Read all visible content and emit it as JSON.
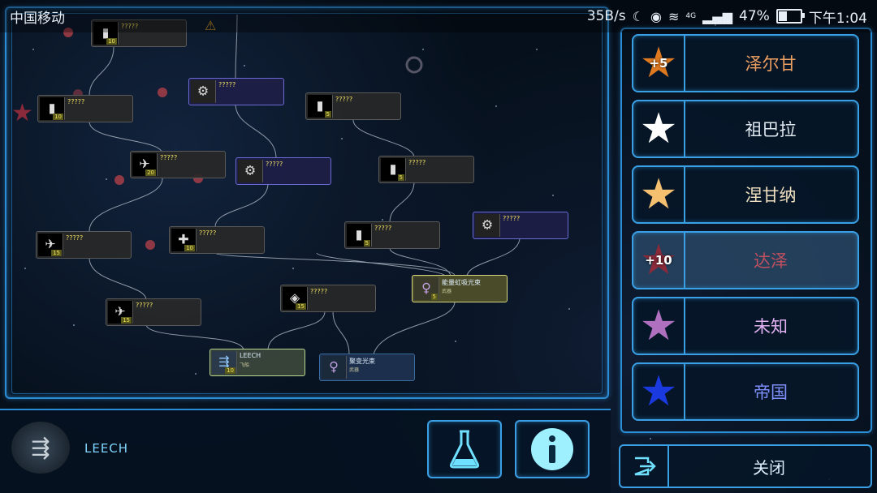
{
  "statusbar": {
    "carrier": "中国移动",
    "speed": "35B/s",
    "network": "4G",
    "battery": "47%",
    "battery_level": 0.47,
    "time": "下午1:04"
  },
  "tree": {
    "nodes": [
      {
        "id": "n1",
        "name": "?????",
        "num": "10",
        "style": "dark"
      },
      {
        "id": "n2",
        "name": "?????",
        "num": "10",
        "style": "dark"
      },
      {
        "id": "n3",
        "name": "?????",
        "num": "",
        "style": "purple"
      },
      {
        "id": "n4",
        "name": "?????",
        "num": "5",
        "style": "dark"
      },
      {
        "id": "n5",
        "name": "?????",
        "num": "20",
        "style": "dark"
      },
      {
        "id": "n6",
        "name": "?????",
        "num": "",
        "style": "purple"
      },
      {
        "id": "n7",
        "name": "?????",
        "num": "5",
        "style": "dark"
      },
      {
        "id": "n8",
        "name": "?????",
        "num": "15",
        "style": "dark"
      },
      {
        "id": "n9",
        "name": "?????",
        "num": "10",
        "style": "dark"
      },
      {
        "id": "n10",
        "name": "?????",
        "num": "5",
        "style": "dark"
      },
      {
        "id": "n11",
        "name": "?????",
        "num": "",
        "style": "purple"
      },
      {
        "id": "n12",
        "name": "?????",
        "num": "15",
        "style": "dark"
      },
      {
        "id": "n13",
        "name": "?????",
        "num": "15",
        "style": "dark"
      },
      {
        "id": "n14",
        "name": "能量虹吸光束",
        "sub": "武器",
        "num": "5",
        "style": "yellow"
      },
      {
        "id": "n15",
        "name": "LEECH",
        "sub": "飞船",
        "num": "10",
        "style": "green"
      },
      {
        "id": "n16",
        "name": "聚变光束",
        "sub": "武器",
        "num": "",
        "style": "blue"
      }
    ]
  },
  "factions": [
    {
      "name": "泽尔甘",
      "badge": "+5",
      "star_color": "#e07a20",
      "text_color": "#f0a060",
      "active": false
    },
    {
      "name": "祖巴拉",
      "badge": "",
      "star_color": "#ffffff",
      "text_color": "#e0e8f0",
      "active": false
    },
    {
      "name": "涅甘纳",
      "badge": "",
      "star_color": "#f4c070",
      "text_color": "#f0e0c0",
      "active": false
    },
    {
      "name": "达泽",
      "badge": "+10",
      "star_color": "#8a2a3a",
      "text_color": "#c05060",
      "active": true
    },
    {
      "name": "未知",
      "badge": "",
      "star_color": "#b070c0",
      "text_color": "#e0b0f0",
      "active": false
    },
    {
      "name": "帝国",
      "badge": "",
      "star_color": "#1a3ae0",
      "text_color": "#8090ff",
      "active": false
    }
  ],
  "selected_ship": {
    "name": "LEECH"
  },
  "actions": {
    "research_icon": "flask-icon",
    "info_icon": "info-icon",
    "close_label": "关闭",
    "close_icon": "exit-icon"
  }
}
